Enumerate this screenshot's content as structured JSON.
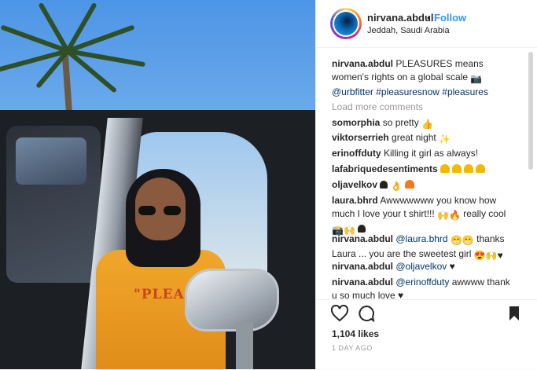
{
  "header": {
    "username": "nirvana.abdul",
    "separator": "•",
    "follow_label": "Follow",
    "location": "Jeddah, Saudi Arabia"
  },
  "caption": {
    "username": "nirvana.abdul",
    "text_1": "PLEASURES means women's rights on a global scale",
    "emoji_1": "camera-emoji",
    "mention": "@urbfitter",
    "hashtags": "#pleasuresnow #pleasures"
  },
  "load_more": "Load more comments",
  "comments": [
    {
      "user": "somorphia",
      "text": "so pretty",
      "emoji": "thumbs-up-emoji"
    },
    {
      "user": "viktorserrieh",
      "text": "great night",
      "emoji": "sparkles-emoji"
    },
    {
      "user": "erinoffduty",
      "text": "Killing it girl as always!"
    },
    {
      "user": "lafabriquedesentiments",
      "text": "",
      "emoji": "yellow-hearts-emoji"
    },
    {
      "user": "oljavelkov",
      "text": "",
      "emoji": "hearts-emoji"
    },
    {
      "user": "laura.bhrd",
      "text": "Awwwwwww you know how much I love your t shirt!!!",
      "text_2": "really cool"
    },
    {
      "user": "nirvana.abdul",
      "mention": "@laura.bhrd",
      "text": "thanks Laura ... you are the sweetest girl"
    },
    {
      "user": "nirvana.abdul",
      "mention": "@oljavelkov",
      "text": "♥"
    },
    {
      "user": "nirvana.abdul",
      "mention": "@erinoffduty",
      "text": "awwww thank u so much love ♥"
    }
  ],
  "stats": {
    "likes": "1,104 likes",
    "time": "1 DAY AGO"
  },
  "photo": {
    "shirt_text": "\"PLEASUR"
  },
  "icons": [
    "heart-icon",
    "comment-icon",
    "bookmark-icon"
  ]
}
